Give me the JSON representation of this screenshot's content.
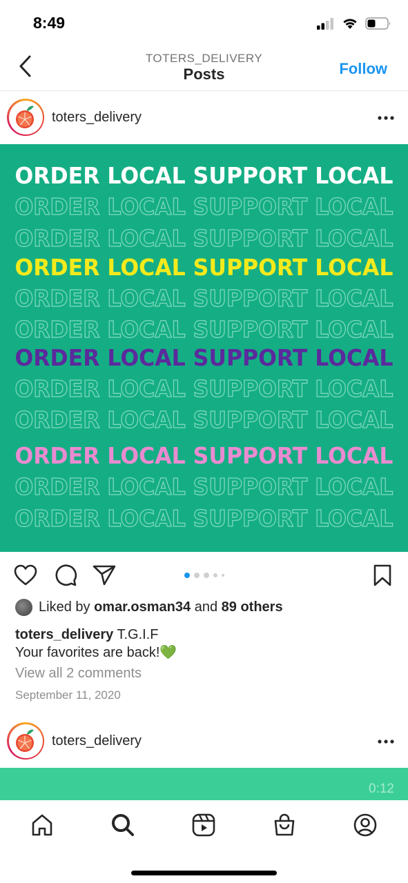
{
  "status_bar": {
    "time": "8:49"
  },
  "nav": {
    "subtitle": "TOTERS_DELIVERY",
    "title": "Posts",
    "follow_label": "Follow"
  },
  "post": {
    "username": "toters_delivery",
    "image": {
      "background_color": "#15ae84",
      "lines": [
        {
          "text": "ORDER LOCAL SUPPORT LOCAL",
          "style": "solid",
          "color": "#ffffff"
        },
        {
          "text": "ORDER LOCAL SUPPORT LOCAL",
          "style": "outline",
          "color": "#7fd9bf"
        },
        {
          "text": "ORDER LOCAL SUPPORT LOCAL",
          "style": "outline",
          "color": "#7fd9bf"
        },
        {
          "text": "ORDER LOCAL SUPPORT LOCAL",
          "style": "solid",
          "color": "#f4ea1c"
        },
        {
          "text": "ORDER LOCAL SUPPORT LOCAL",
          "style": "outline",
          "color": "#7fd9bf"
        },
        {
          "text": "ORDER LOCAL SUPPORT LOCAL",
          "style": "outline",
          "color": "#7fd9bf"
        },
        {
          "text": "ORDER LOCAL SUPPORT LOCAL",
          "style": "solid",
          "color": "#5b2a9c"
        },
        {
          "text": "ORDER LOCAL SUPPORT LOCAL",
          "style": "outline",
          "color": "#7fd9bf"
        },
        {
          "text": "ORDER LOCAL SUPPORT LOCAL",
          "style": "outline",
          "color": "#7fd9bf"
        },
        {
          "text": "ORDER LOCAL SUPPORT LOCAL",
          "style": "solid",
          "color": "#e98bd0"
        },
        {
          "text": "ORDER LOCAL SUPPORT LOCAL",
          "style": "outline",
          "color": "#7fd9bf"
        },
        {
          "text": "ORDER LOCAL SUPPORT LOCAL",
          "style": "outline",
          "color": "#7fd9bf"
        }
      ]
    },
    "carousel": {
      "count": 5,
      "active_index": 0
    },
    "liked_by_prefix": "Liked by",
    "liked_by_user": "omar.osman34",
    "liked_by_and": "and",
    "liked_by_others": "89 others",
    "caption_user": "toters_delivery",
    "caption_line1": "T.G.I.F",
    "caption_line2": "Your favorites are back!💚",
    "view_comments": "View all 2 comments",
    "date": "September 11, 2020"
  },
  "next_post": {
    "username": "toters_delivery",
    "video_time": "0:12",
    "image_color": "#3bcf97"
  },
  "tab_bar": {
    "items": [
      {
        "name": "home",
        "icon": "home-icon"
      },
      {
        "name": "search",
        "icon": "search-icon",
        "active": true
      },
      {
        "name": "reels",
        "icon": "reels-icon"
      },
      {
        "name": "shop",
        "icon": "shop-icon"
      },
      {
        "name": "profile",
        "icon": "profile-icon"
      }
    ]
  },
  "colors": {
    "accent": "#1a95f0",
    "text": "#262626",
    "muted": "#8e8e8e"
  }
}
